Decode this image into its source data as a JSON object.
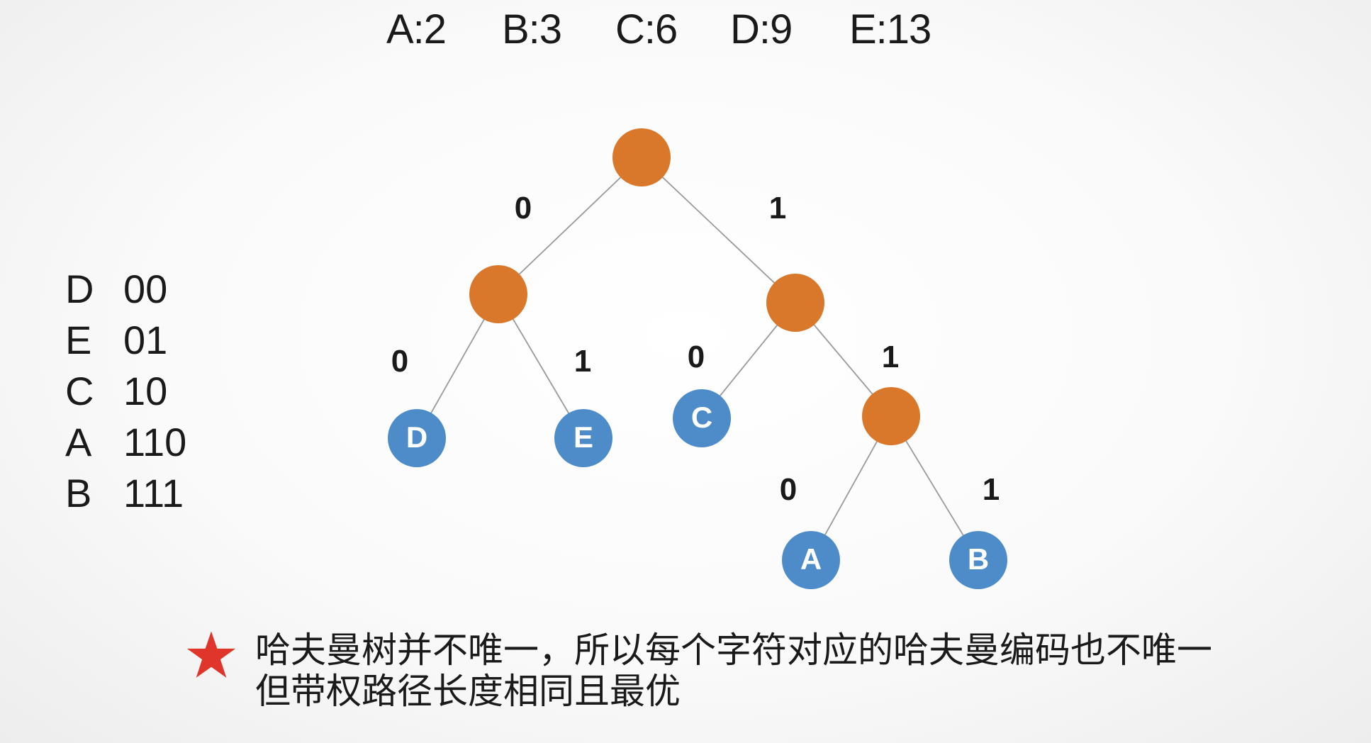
{
  "frequencies": [
    {
      "label": "A:2"
    },
    {
      "label": "B:3"
    },
    {
      "label": "C:6"
    },
    {
      "label": "D:9"
    },
    {
      "label": "E:13"
    }
  ],
  "codes": [
    {
      "letter": "D",
      "code": "00"
    },
    {
      "letter": "E",
      "code": "01"
    },
    {
      "letter": "C",
      "code": "10"
    },
    {
      "letter": "A",
      "code": "110"
    },
    {
      "letter": "B",
      "code": "111"
    }
  ],
  "tree": {
    "leaves": {
      "D": "D",
      "E": "E",
      "C": "C",
      "A": "A",
      "B": "B"
    },
    "edge_labels": {
      "root_left": "0",
      "root_right": "1",
      "l_left": "0",
      "l_right": "1",
      "r_left": "0",
      "r_right": "1",
      "rr_left": "0",
      "rr_right": "1"
    },
    "colors": {
      "internal_node": "#d9772b",
      "leaf_node": "#4e8cc9",
      "edge": "#9a9a9a"
    }
  },
  "note": {
    "icon": "star-icon",
    "icon_color": "#e0352b",
    "line1": "哈夫曼树并不唯一，所以每个字符对应的哈夫曼编码也不唯一",
    "line2": "但带权路径长度相同且最优"
  }
}
